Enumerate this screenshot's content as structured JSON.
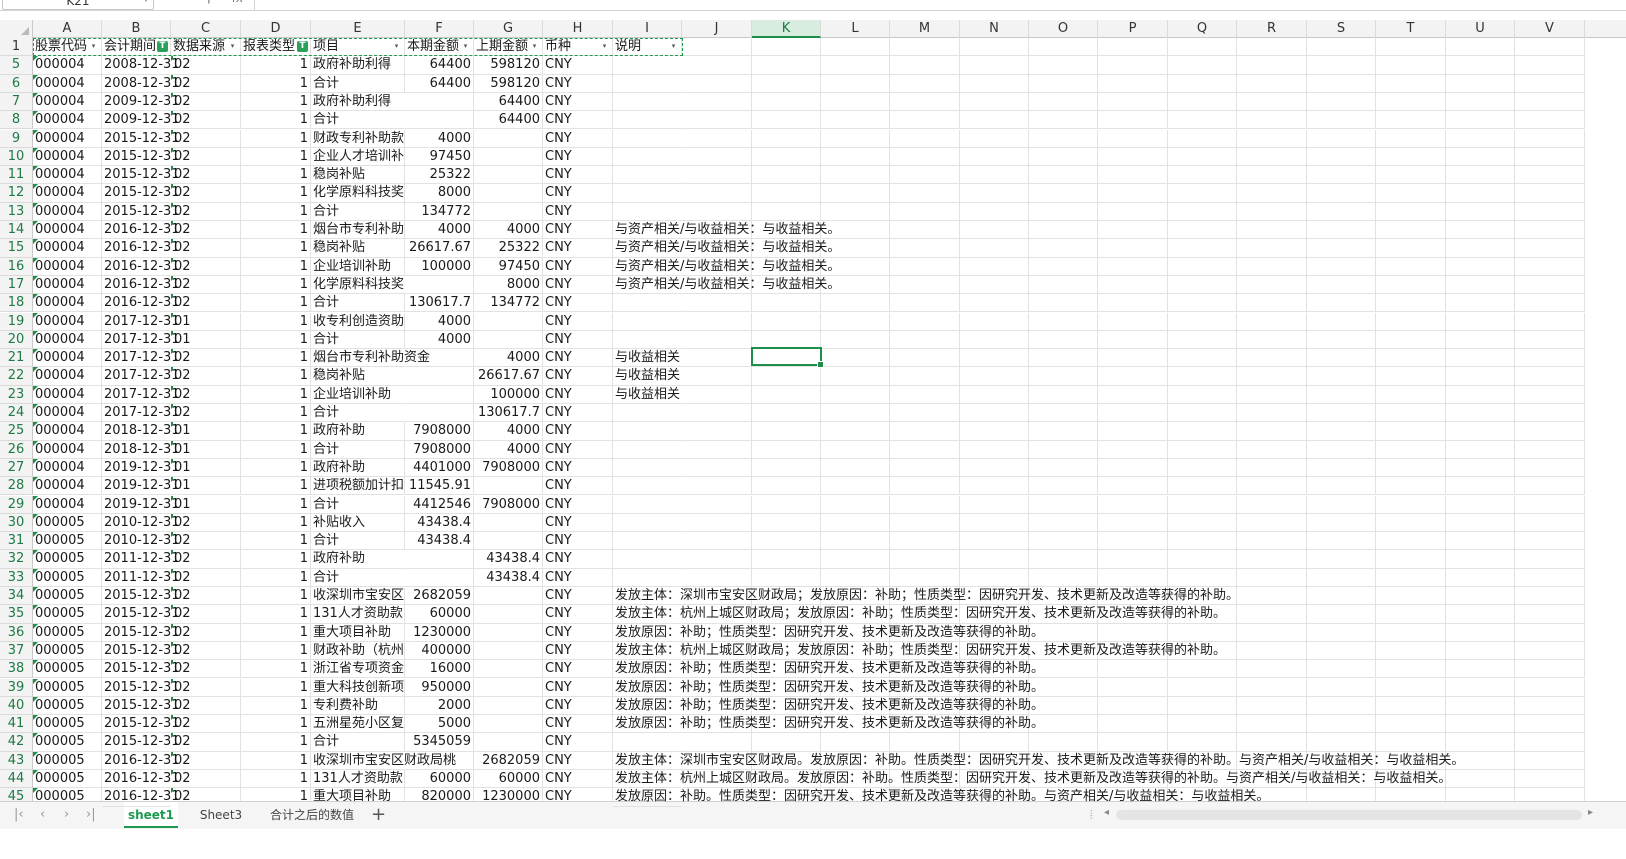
{
  "name_box": "K21",
  "formula_label": "fx",
  "active_cell": "K21",
  "columns": [
    "A",
    "B",
    "C",
    "D",
    "E",
    "F",
    "G",
    "H",
    "I",
    "J",
    "K",
    "L",
    "M",
    "N",
    "O",
    "P",
    "Q",
    "R",
    "S",
    "T",
    "U",
    "V"
  ],
  "header_row": {
    "row_number": "1",
    "cells": [
      "股票代码",
      "会计期间",
      "数据来源",
      "报表类型",
      "项目",
      "本期金额",
      "上期金额",
      "币种",
      "说明"
    ]
  },
  "rows": [
    {
      "n": "5",
      "a": "000004",
      "b": "2008-12-31",
      "c": "02",
      "d": "1",
      "e": "政府补助利得",
      "f": "64400",
      "g": "598120",
      "h": "CNY",
      "i": ""
    },
    {
      "n": "6",
      "a": "000004",
      "b": "2008-12-31",
      "c": "02",
      "d": "1",
      "e": "合计",
      "f": "64400",
      "g": "598120",
      "h": "CNY",
      "i": ""
    },
    {
      "n": "7",
      "a": "000004",
      "b": "2009-12-31",
      "c": "02",
      "d": "1",
      "e": "政府补助利得",
      "f": "",
      "g": "64400",
      "h": "CNY",
      "i": ""
    },
    {
      "n": "8",
      "a": "000004",
      "b": "2009-12-31",
      "c": "02",
      "d": "1",
      "e": "合计",
      "f": "",
      "g": "64400",
      "h": "CNY",
      "i": ""
    },
    {
      "n": "9",
      "a": "000004",
      "b": "2015-12-31",
      "c": "02",
      "d": "1",
      "e": "财政专利补助款",
      "f": "4000",
      "g": "",
      "h": "CNY",
      "i": ""
    },
    {
      "n": "10",
      "a": "000004",
      "b": "2015-12-31",
      "c": "02",
      "d": "1",
      "e": "企业人才培训补贴",
      "f": "97450",
      "g": "",
      "h": "CNY",
      "i": ""
    },
    {
      "n": "11",
      "a": "000004",
      "b": "2015-12-31",
      "c": "02",
      "d": "1",
      "e": "稳岗补贴",
      "f": "25322",
      "g": "",
      "h": "CNY",
      "i": ""
    },
    {
      "n": "12",
      "a": "000004",
      "b": "2015-12-31",
      "c": "02",
      "d": "1",
      "e": "化学原料科技奖",
      "f": "8000",
      "g": "",
      "h": "CNY",
      "i": ""
    },
    {
      "n": "13",
      "a": "000004",
      "b": "2015-12-31",
      "c": "02",
      "d": "1",
      "e": "合计",
      "f": "134772",
      "g": "",
      "h": "CNY",
      "i": ""
    },
    {
      "n": "14",
      "a": "000004",
      "b": "2016-12-31",
      "c": "02",
      "d": "1",
      "e": "烟台市专利补助",
      "f": "4000",
      "g": "4000",
      "h": "CNY",
      "i": "与资产相关/与收益相关：与收益相关。"
    },
    {
      "n": "15",
      "a": "000004",
      "b": "2016-12-31",
      "c": "02",
      "d": "1",
      "e": "稳岗补贴",
      "f": "26617.67",
      "g": "25322",
      "h": "CNY",
      "i": "与资产相关/与收益相关：与收益相关。"
    },
    {
      "n": "16",
      "a": "000004",
      "b": "2016-12-31",
      "c": "02",
      "d": "1",
      "e": "企业培训补助",
      "f": "100000",
      "g": "97450",
      "h": "CNY",
      "i": "与资产相关/与收益相关：与收益相关。"
    },
    {
      "n": "17",
      "a": "000004",
      "b": "2016-12-31",
      "c": "02",
      "d": "1",
      "e": "化学原料科技奖",
      "f": "",
      "g": "8000",
      "h": "CNY",
      "i": "与资产相关/与收益相关：与收益相关。"
    },
    {
      "n": "18",
      "a": "000004",
      "b": "2016-12-31",
      "c": "02",
      "d": "1",
      "e": "合计",
      "f": "130617.7",
      "g": "134772",
      "h": "CNY",
      "i": ""
    },
    {
      "n": "19",
      "a": "000004",
      "b": "2017-12-31",
      "c": "01",
      "d": "1",
      "e": "收专利创造资助",
      "f": "4000",
      "g": "",
      "h": "CNY",
      "i": ""
    },
    {
      "n": "20",
      "a": "000004",
      "b": "2017-12-31",
      "c": "01",
      "d": "1",
      "e": "合计",
      "f": "4000",
      "g": "",
      "h": "CNY",
      "i": ""
    },
    {
      "n": "21",
      "a": "000004",
      "b": "2017-12-31",
      "c": "02",
      "d": "1",
      "e": "烟台市专利补助资金",
      "f": "",
      "g": "4000",
      "h": "CNY",
      "i": "与收益相关"
    },
    {
      "n": "22",
      "a": "000004",
      "b": "2017-12-31",
      "c": "02",
      "d": "1",
      "e": "稳岗补贴",
      "f": "",
      "g": "26617.67",
      "h": "CNY",
      "i": "与收益相关"
    },
    {
      "n": "23",
      "a": "000004",
      "b": "2017-12-31",
      "c": "02",
      "d": "1",
      "e": "企业培训补助",
      "f": "",
      "g": "100000",
      "h": "CNY",
      "i": "与收益相关"
    },
    {
      "n": "24",
      "a": "000004",
      "b": "2017-12-31",
      "c": "02",
      "d": "1",
      "e": "合计",
      "f": "",
      "g": "130617.7",
      "h": "CNY",
      "i": ""
    },
    {
      "n": "25",
      "a": "000004",
      "b": "2018-12-31",
      "c": "01",
      "d": "1",
      "e": "政府补助",
      "f": "7908000",
      "g": "4000",
      "h": "CNY",
      "i": ""
    },
    {
      "n": "26",
      "a": "000004",
      "b": "2018-12-31",
      "c": "01",
      "d": "1",
      "e": "合计",
      "f": "7908000",
      "g": "4000",
      "h": "CNY",
      "i": ""
    },
    {
      "n": "27",
      "a": "000004",
      "b": "2019-12-31",
      "c": "01",
      "d": "1",
      "e": "政府补助",
      "f": "4401000",
      "g": "7908000",
      "h": "CNY",
      "i": ""
    },
    {
      "n": "28",
      "a": "000004",
      "b": "2019-12-31",
      "c": "01",
      "d": "1",
      "e": "进项税额加计扣除",
      "f": "11545.91",
      "g": "",
      "h": "CNY",
      "i": ""
    },
    {
      "n": "29",
      "a": "000004",
      "b": "2019-12-31",
      "c": "01",
      "d": "1",
      "e": "合计",
      "f": "4412546",
      "g": "7908000",
      "h": "CNY",
      "i": ""
    },
    {
      "n": "30",
      "a": "000005",
      "b": "2010-12-31",
      "c": "02",
      "d": "1",
      "e": "补贴收入",
      "f": "43438.4",
      "g": "",
      "h": "CNY",
      "i": ""
    },
    {
      "n": "31",
      "a": "000005",
      "b": "2010-12-31",
      "c": "02",
      "d": "1",
      "e": "合计",
      "f": "43438.4",
      "g": "",
      "h": "CNY",
      "i": ""
    },
    {
      "n": "32",
      "a": "000005",
      "b": "2011-12-31",
      "c": "02",
      "d": "1",
      "e": "政府补助",
      "f": "",
      "g": "43438.4",
      "h": "CNY",
      "i": ""
    },
    {
      "n": "33",
      "a": "000005",
      "b": "2011-12-31",
      "c": "02",
      "d": "1",
      "e": "合计",
      "f": "",
      "g": "43438.4",
      "h": "CNY",
      "i": ""
    },
    {
      "n": "34",
      "a": "000005",
      "b": "2015-12-31",
      "c": "02",
      "d": "1",
      "e": "收深圳市宝安区",
      "f": "2682059",
      "g": "",
      "h": "CNY",
      "i": "发放主体：深圳市宝安区财政局；发放原因：补助；性质类型：因研究开发、技术更新及改造等获得的补助。"
    },
    {
      "n": "35",
      "a": "000005",
      "b": "2015-12-31",
      "c": "02",
      "d": "1",
      "e": "131人才资助款",
      "f": "60000",
      "g": "",
      "h": "CNY",
      "i": "发放主体：杭州上城区财政局；发放原因：补助；性质类型：因研究开发、技术更新及改造等获得的补助。"
    },
    {
      "n": "36",
      "a": "000005",
      "b": "2015-12-31",
      "c": "02",
      "d": "1",
      "e": "重大项目补助",
      "f": "1230000",
      "g": "",
      "h": "CNY",
      "i": "发放原因：补助；性质类型：因研究开发、技术更新及改造等获得的补助。"
    },
    {
      "n": "37",
      "a": "000005",
      "b": "2015-12-31",
      "c": "02",
      "d": "1",
      "e": "财政补助（杭州",
      "f": "400000",
      "g": "",
      "h": "CNY",
      "i": "发放主体：杭州上城区财政局；发放原因：补助；性质类型：因研究开发、技术更新及改造等获得的补助。"
    },
    {
      "n": "38",
      "a": "000005",
      "b": "2015-12-31",
      "c": "02",
      "d": "1",
      "e": "浙江省专项资金",
      "f": "16000",
      "g": "",
      "h": "CNY",
      "i": "发放原因：补助；性质类型：因研究开发、技术更新及改造等获得的补助。"
    },
    {
      "n": "39",
      "a": "000005",
      "b": "2015-12-31",
      "c": "02",
      "d": "1",
      "e": "重大科技创新项",
      "f": "950000",
      "g": "",
      "h": "CNY",
      "i": "发放原因：补助；性质类型：因研究开发、技术更新及改造等获得的补助。"
    },
    {
      "n": "40",
      "a": "000005",
      "b": "2015-12-31",
      "c": "02",
      "d": "1",
      "e": "专利费补助",
      "f": "2000",
      "g": "",
      "h": "CNY",
      "i": "发放原因：补助；性质类型：因研究开发、技术更新及改造等获得的补助。"
    },
    {
      "n": "41",
      "a": "000005",
      "b": "2015-12-31",
      "c": "02",
      "d": "1",
      "e": "五洲星苑小区复",
      "f": "5000",
      "g": "",
      "h": "CNY",
      "i": "发放原因：补助；性质类型：因研究开发、技术更新及改造等获得的补助。"
    },
    {
      "n": "42",
      "a": "000005",
      "b": "2015-12-31",
      "c": "02",
      "d": "1",
      "e": "合计",
      "f": "5345059",
      "g": "",
      "h": "CNY",
      "i": ""
    },
    {
      "n": "43",
      "a": "000005",
      "b": "2016-12-31",
      "c": "02",
      "d": "1",
      "e": "收深圳市宝安区财政局桃",
      "f": "",
      "g": "2682059",
      "h": "CNY",
      "i": "发放主体：深圳市宝安区财政局。发放原因：补助。性质类型：因研究开发、技术更新及改造等获得的补助。与资产相关/与收益相关：与收益相关。"
    },
    {
      "n": "44",
      "a": "000005",
      "b": "2016-12-31",
      "c": "02",
      "d": "1",
      "e": "131人才资助款",
      "f": "60000",
      "g": "60000",
      "h": "CNY",
      "i": "发放主体：杭州上城区财政局。发放原因：补助。性质类型：因研究开发、技术更新及改造等获得的补助。与资产相关/与收益相关：与收益相关。"
    },
    {
      "n": "45",
      "a": "000005",
      "b": "2016-12-31",
      "c": "02",
      "d": "1",
      "e": "重大项目补助",
      "f": "820000",
      "g": "1230000",
      "h": "CNY",
      "i": "发放原因：补助。性质类型：因研究开发、技术更新及改造等获得的补助。与资产相关/与收益相关：与收益相关。"
    }
  ],
  "sheet_tabs": [
    "sheet1",
    "Sheet3",
    "合计之后的数值"
  ],
  "active_sheet": "sheet1",
  "accent_color": "#1e9a50"
}
